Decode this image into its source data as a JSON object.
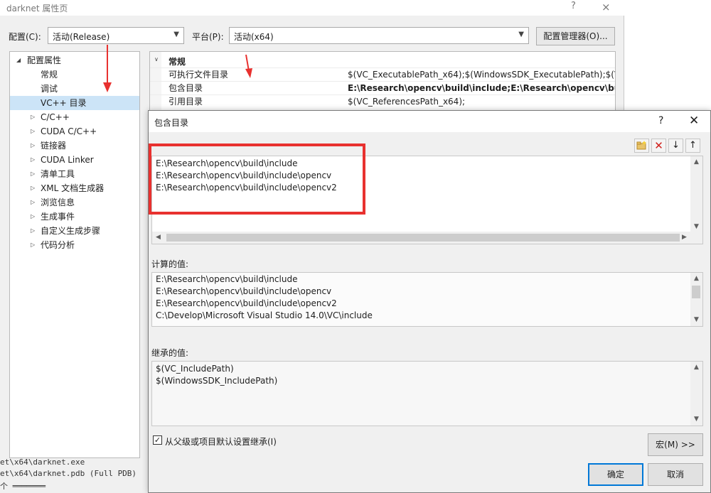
{
  "bg_window": {
    "title": "darknet 属性页",
    "help": "?",
    "close": "×",
    "config_label": "配置(C):",
    "config_value": "活动(Release)",
    "platform_label": "平台(P):",
    "platform_value": "活动(x64)",
    "config_manager": "配置管理器(O)..."
  },
  "tree": {
    "root": "配置属性",
    "items": [
      {
        "label": "常规"
      },
      {
        "label": "调试"
      },
      {
        "label": "VC++ 目录"
      },
      {
        "label": "C/C++"
      },
      {
        "label": "CUDA C/C++"
      },
      {
        "label": "链接器"
      },
      {
        "label": "CUDA Linker"
      },
      {
        "label": "清单工具"
      },
      {
        "label": "XML 文档生成器"
      },
      {
        "label": "浏览信息"
      },
      {
        "label": "生成事件"
      },
      {
        "label": "自定义生成步骤"
      },
      {
        "label": "代码分析"
      }
    ]
  },
  "grid": {
    "section": "常规",
    "rows": [
      {
        "name": "可执行文件目录",
        "value": "$(VC_ExecutablePath_x64);$(WindowsSDK_ExecutablePath);$(VS_E"
      },
      {
        "name": "包含目录",
        "value": "E:\\Research\\opencv\\build\\include;E:\\Research\\opencv\\build\\"
      },
      {
        "name": "引用目录",
        "value": "$(VC_ReferencesPath_x64);"
      }
    ]
  },
  "console": [
    "et\\x64\\darknet.exe",
    "et\\x64\\darknet.pdb (Full PDB)",
    "个 ═══════"
  ],
  "dialog": {
    "title": "包含目录",
    "help": "?",
    "close": "✕",
    "edit_lines": [
      "E:\\Research\\opencv\\build\\include",
      "E:\\Research\\opencv\\build\\include\\opencv",
      "E:\\Research\\opencv\\build\\include\\opencv2"
    ],
    "computed_label": "计算的值:",
    "computed_lines": [
      "E:\\Research\\opencv\\build\\include",
      "E:\\Research\\opencv\\build\\include\\opencv",
      "E:\\Research\\opencv\\build\\include\\opencv2",
      "C:\\Develop\\Microsoft Visual Studio 14.0\\VC\\include"
    ],
    "inherited_label": "继承的值:",
    "inherited_lines": [
      "$(VC_IncludePath)",
      "$(WindowsSDK_IncludePath)"
    ],
    "inherit_checkbox": "从父级或项目默认设置继承(I)",
    "inherit_checked": true,
    "macro_button": "宏(M) >>",
    "ok_button": "确定",
    "cancel_button": "取消"
  },
  "colors": {
    "annotation_red": "#e8312f",
    "selection_blue": "#cce4f7",
    "primary_border": "#0078d7"
  }
}
